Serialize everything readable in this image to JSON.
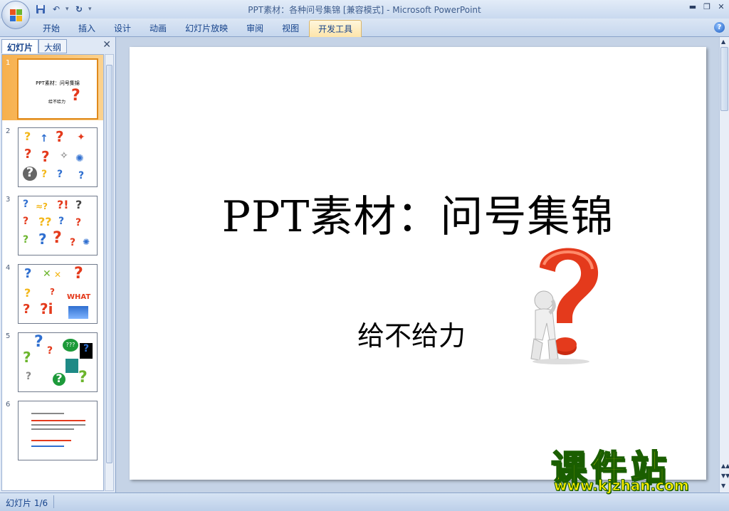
{
  "window": {
    "title": "PPT素材：各种问号集锦 [兼容模式]",
    "separator": " - ",
    "app_name": "Microsoft PowerPoint"
  },
  "qat": {
    "undo_dropdown": "▾",
    "customize": "▾"
  },
  "ribbon": {
    "tabs": [
      "开始",
      "插入",
      "设计",
      "动画",
      "幻灯片放映",
      "审阅",
      "视图",
      "开发工具"
    ],
    "active_tab_index": 7
  },
  "left_pane": {
    "tabs": [
      "幻灯片",
      "大纲"
    ],
    "active_tab_index": 0,
    "close_glyph": "✕",
    "slides": [
      {
        "number": "1",
        "selected": true,
        "title": "PPT素材：问号集锦",
        "subtitle": "给不给力"
      },
      {
        "number": "2",
        "selected": false
      },
      {
        "number": "3",
        "selected": false
      },
      {
        "number": "4",
        "selected": false,
        "label": "WHAT"
      },
      {
        "number": "5",
        "selected": false
      },
      {
        "number": "6",
        "selected": false
      }
    ]
  },
  "slide": {
    "title": "PPT素材：问号集锦",
    "subtitle": "给不给力"
  },
  "status": {
    "slide_indicator": "幻灯片 1/6"
  },
  "watermark": {
    "brand": "课件站",
    "url": "www.kjzhan.com"
  },
  "colors": {
    "active_tab": "#fde4a8",
    "selected_slide": "#f7b04d",
    "question_red": "#e43a1c",
    "watermark_yellow": "#ffee00",
    "watermark_green": "#1a5e00"
  }
}
